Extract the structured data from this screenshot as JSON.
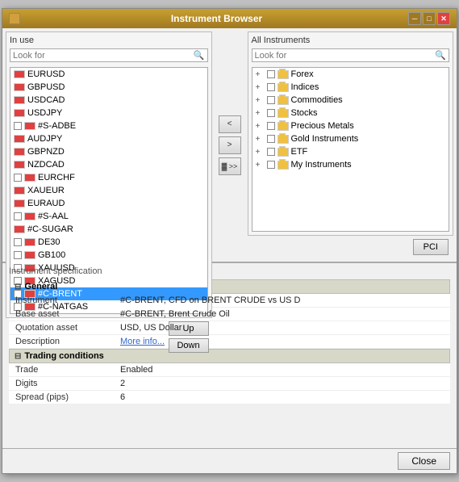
{
  "window": {
    "title": "Instrument Browser",
    "icon": "📊"
  },
  "left_panel": {
    "label": "In use",
    "search_placeholder": "Look for",
    "search_value": "",
    "items": [
      {
        "id": "eurusd",
        "checkbox": false,
        "flag": "red",
        "label": "EURUSD",
        "selected": false
      },
      {
        "id": "gbpusd",
        "checkbox": false,
        "flag": "red",
        "label": "GBPUSD",
        "selected": false
      },
      {
        "id": "usdcad",
        "checkbox": false,
        "flag": "red",
        "label": "USDCAD",
        "selected": false
      },
      {
        "id": "usdjpy",
        "checkbox": false,
        "flag": "red",
        "label": "USDJPY",
        "selected": false
      },
      {
        "id": "s-adbe",
        "checkbox": true,
        "flag": "red",
        "label": "#S-ADBE",
        "selected": false
      },
      {
        "id": "audjpy",
        "checkbox": false,
        "flag": "red",
        "label": "AUDJPY",
        "selected": false
      },
      {
        "id": "gbpnzd",
        "checkbox": false,
        "flag": "red",
        "label": "GBPNZD",
        "selected": false
      },
      {
        "id": "nzdcad",
        "checkbox": false,
        "flag": "red",
        "label": "NZDCAD",
        "selected": false
      },
      {
        "id": "eurchf",
        "checkbox": true,
        "flag": "red",
        "label": "EURCHF",
        "selected": false
      },
      {
        "id": "xaueur",
        "checkbox": false,
        "flag": "red",
        "label": "XAUEUR",
        "selected": false
      },
      {
        "id": "euraud",
        "checkbox": false,
        "flag": "red",
        "label": "EURAUD",
        "selected": false
      },
      {
        "id": "s-aal",
        "checkbox": true,
        "flag": "red",
        "label": "#S-AAL",
        "selected": false
      },
      {
        "id": "c-sugar",
        "checkbox": false,
        "flag": "red",
        "label": "#C-SUGAR",
        "selected": false
      },
      {
        "id": "de30",
        "checkbox": true,
        "flag": "orange",
        "label": "DE30",
        "selected": false
      },
      {
        "id": "gb100",
        "checkbox": true,
        "flag": "orange",
        "label": "GB100",
        "selected": false
      },
      {
        "id": "xauusd",
        "checkbox": true,
        "flag": "red",
        "label": "XAUUSD",
        "selected": false
      },
      {
        "id": "xagusd",
        "checkbox": true,
        "flag": "red",
        "label": "XAGUSD",
        "selected": false
      },
      {
        "id": "c-brent",
        "checkbox": true,
        "flag": "orange",
        "label": "#C-BRENT",
        "selected": true
      },
      {
        "id": "c-natgas",
        "checkbox": true,
        "flag": "orange",
        "label": "#C-NATGAS",
        "selected": false
      }
    ],
    "up_label": "Up",
    "down_label": "Down"
  },
  "middle": {
    "left_arrow": "<",
    "right_arrow": ">",
    "double_left": "◄◄",
    "transfer_label": "<<"
  },
  "right_panel": {
    "label": "All Instruments",
    "search_placeholder": "Look for",
    "search_value": "",
    "tree_items": [
      {
        "id": "forex",
        "label": "Forex",
        "expanded": true,
        "indent": 0
      },
      {
        "id": "indices",
        "label": "Indices",
        "expanded": true,
        "indent": 0
      },
      {
        "id": "commodities",
        "label": "Commodities",
        "expanded": true,
        "indent": 0
      },
      {
        "id": "stocks",
        "label": "Stocks",
        "expanded": true,
        "indent": 0
      },
      {
        "id": "precious-metals",
        "label": "Precious Metals",
        "expanded": true,
        "indent": 0
      },
      {
        "id": "gold-instruments",
        "label": "Gold Instruments",
        "expanded": true,
        "indent": 0
      },
      {
        "id": "etf",
        "label": "ETF",
        "expanded": true,
        "indent": 0
      },
      {
        "id": "my-instruments",
        "label": "My Instruments",
        "expanded": true,
        "indent": 0
      }
    ],
    "pci_label": "PCI"
  },
  "spec_section": {
    "title": "Instrument specification",
    "groups": [
      {
        "name": "General",
        "expanded": true,
        "rows": [
          {
            "label": "Instrument",
            "value": "#C-BRENT, CFD on BRENT CRUDE vs US D",
            "bold": true
          },
          {
            "label": "Base asset",
            "value": "#C-BRENT, Brent Crude Oil",
            "bold": false
          },
          {
            "label": "Quotation asset",
            "value": "USD, US Dollar",
            "bold": false
          },
          {
            "label": "Description",
            "value": "More info...",
            "is_link": true,
            "link_text": "More info..."
          }
        ]
      },
      {
        "name": "Trading conditions",
        "expanded": true,
        "rows": [
          {
            "label": "Trade",
            "value": "Enabled",
            "bold": false
          },
          {
            "label": "Digits",
            "value": "2",
            "bold": false
          },
          {
            "label": "Spread (pips)",
            "value": "6",
            "bold": false
          }
        ]
      }
    ]
  },
  "footer": {
    "close_label": "Close"
  }
}
